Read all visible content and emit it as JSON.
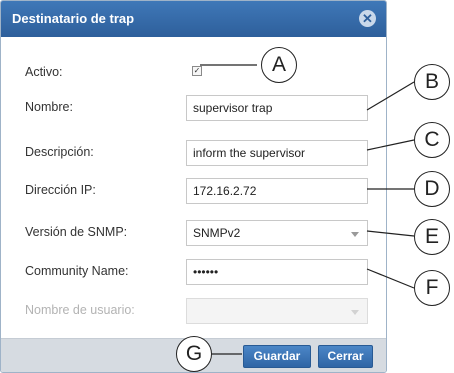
{
  "dialog": {
    "title": "Destinatario de trap",
    "close_icon": "close-circle-icon"
  },
  "fields": {
    "activo": {
      "label": "Activo:",
      "checked": true
    },
    "nombre": {
      "label": "Nombre:",
      "value": "supervisor trap"
    },
    "descripcion": {
      "label": "Descripción:",
      "value": "inform the supervisor"
    },
    "direccion_ip": {
      "label": "Dirección IP:",
      "value": "172.16.2.72"
    },
    "version_snmp": {
      "label": "Versión de SNMP:",
      "value": "SNMPv2"
    },
    "community_name": {
      "label": "Community Name:",
      "value": "••••••"
    },
    "nombre_usuario": {
      "label": "Nombre de usuario:",
      "value": ""
    }
  },
  "buttons": {
    "guardar": "Guardar",
    "cerrar": "Cerrar"
  },
  "callouts": [
    "A",
    "B",
    "C",
    "D",
    "E",
    "F",
    "G"
  ],
  "colors": {
    "titlebar": "#2e5f9b",
    "button": "#2f65a5",
    "footer": "#d6dbe1"
  }
}
